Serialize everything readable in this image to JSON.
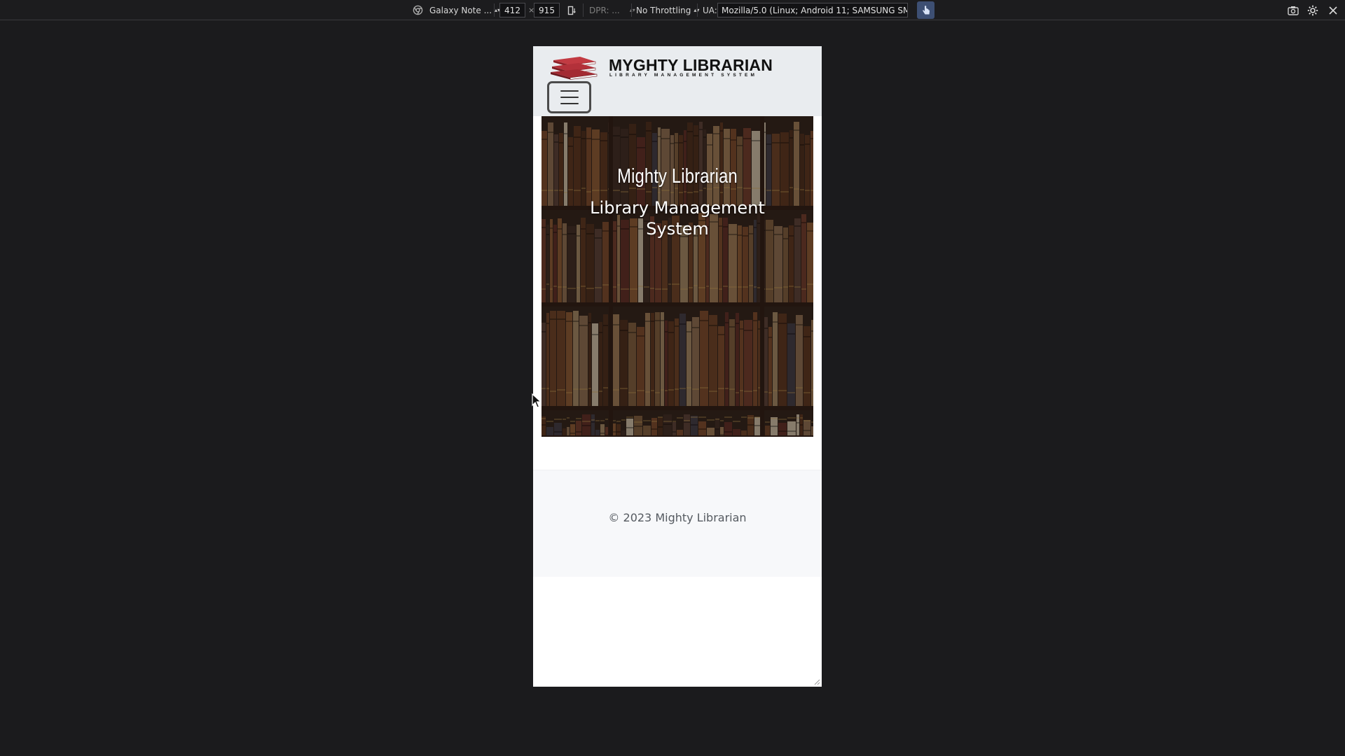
{
  "devtools": {
    "device_name": "Galaxy Note ...",
    "width": "412",
    "times": "×",
    "height": "915",
    "dpr_label": "DPR: ...",
    "throttling": "No Throttling",
    "ua_label": "UA:",
    "ua_value": "Mozilla/5.0 (Linux; Android 11; SAMSUNG SM-G97"
  },
  "site": {
    "brand_title": "MYGHTY LIBRARIAN",
    "brand_subtitle": "LIBRARY MANAGEMENT SYSTEM",
    "hero_title": "Mighty Librarian",
    "hero_subtitle": "Library Management System",
    "footer_text": "© 2023 Mighty Librarian"
  },
  "colors": {
    "header_bg": "#e9ecef",
    "footer_bg": "#f7f8fa",
    "logo_red": "#b2323a",
    "devtools_bg": "#1c1c1e",
    "page_bg": "#1b1b1d",
    "touch_active": "#3d4f73"
  },
  "icons": {
    "device_icon": "chrome-device-icon",
    "rotate": "rotate-icon",
    "touch": "touch-icon",
    "screenshot": "camera-icon",
    "settings": "gear-icon",
    "close": "close-icon",
    "menu": "hamburger-icon"
  }
}
